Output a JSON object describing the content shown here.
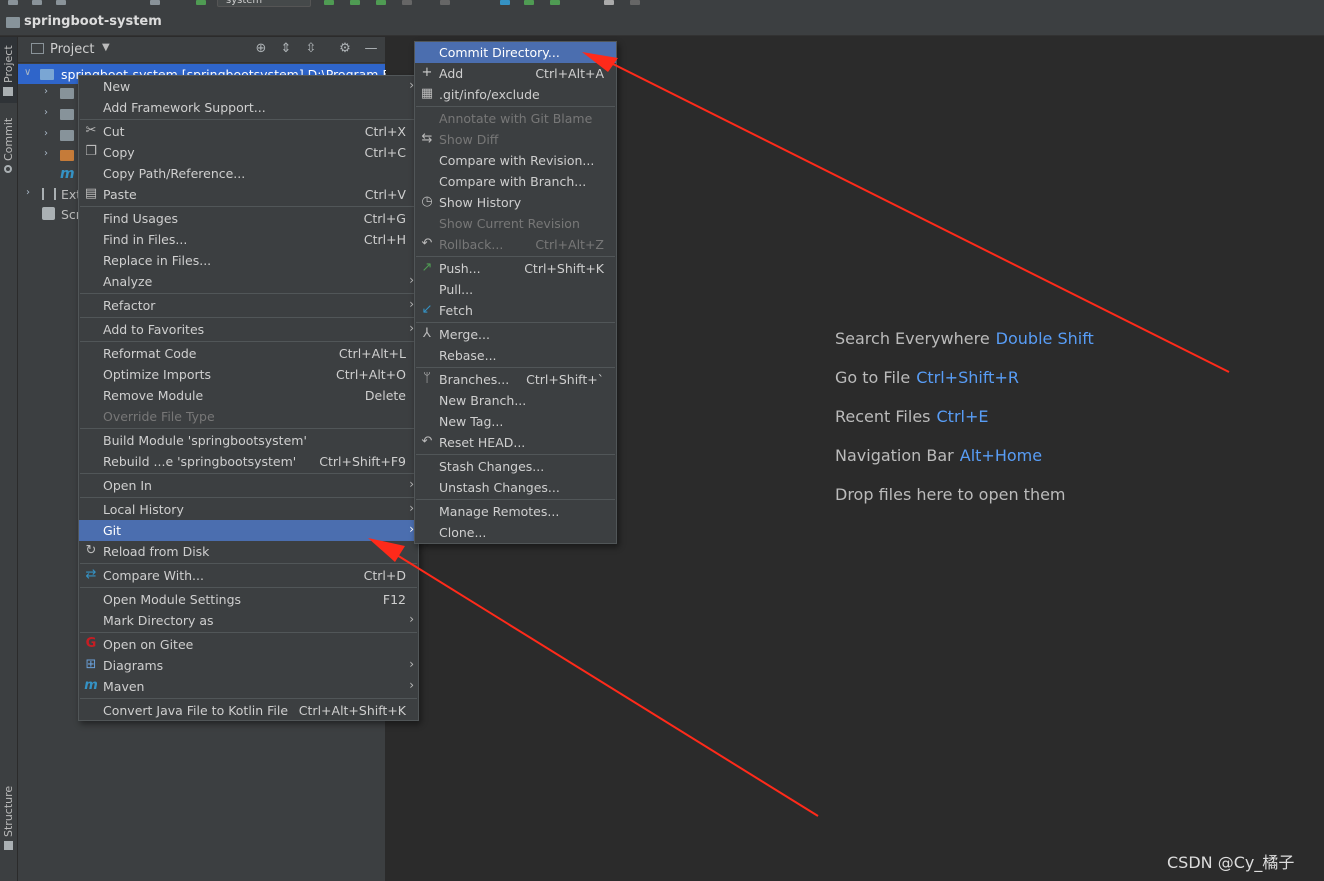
{
  "window": {
    "title": "springboot-system",
    "run_config": "system"
  },
  "left_strip": {
    "tabs": [
      "Project",
      "Commit",
      "Structure"
    ]
  },
  "project_panel": {
    "title": "Project",
    "tree": [
      {
        "text": "springboot-system [springbootsystem]  D:\\Program Fil",
        "selected": true
      },
      {
        "text": "",
        "folder": "gray"
      },
      {
        "text": "",
        "folder": "gray"
      },
      {
        "text": "",
        "folder": "gray"
      },
      {
        "text": "",
        "folder": "orange"
      },
      {
        "text": "",
        "icon": "maven-icon"
      },
      {
        "text": "Ext"
      },
      {
        "text": "Scr"
      }
    ]
  },
  "context_menu": {
    "items": [
      {
        "label": "New",
        "submenu": true
      },
      {
        "label": "Add Framework Support..."
      },
      {
        "sep": true
      },
      {
        "label": "Cut",
        "shortcut": "Ctrl+X",
        "icon": "scissors-icon"
      },
      {
        "label": "Copy",
        "shortcut": "Ctrl+C",
        "icon": "copy-icon"
      },
      {
        "label": "Copy Path/Reference..."
      },
      {
        "label": "Paste",
        "shortcut": "Ctrl+V",
        "icon": "paste-icon"
      },
      {
        "sep": true
      },
      {
        "label": "Find Usages",
        "shortcut": "Ctrl+G"
      },
      {
        "label": "Find in Files...",
        "shortcut": "Ctrl+H"
      },
      {
        "label": "Replace in Files..."
      },
      {
        "label": "Analyze",
        "submenu": true
      },
      {
        "sep": true
      },
      {
        "label": "Refactor",
        "submenu": true
      },
      {
        "sep": true
      },
      {
        "label": "Add to Favorites",
        "submenu": true
      },
      {
        "sep": true
      },
      {
        "label": "Reformat Code",
        "shortcut": "Ctrl+Alt+L"
      },
      {
        "label": "Optimize Imports",
        "shortcut": "Ctrl+Alt+O"
      },
      {
        "label": "Remove Module",
        "shortcut": "Delete"
      },
      {
        "label": "Override File Type",
        "disabled": true
      },
      {
        "sep": true
      },
      {
        "label": "Build Module 'springbootsystem'"
      },
      {
        "label": "Rebuild ...e 'springbootsystem'",
        "shortcut": "Ctrl+Shift+F9"
      },
      {
        "sep": true
      },
      {
        "label": "Open In",
        "submenu": true
      },
      {
        "sep": true
      },
      {
        "label": "Local History",
        "submenu": true
      },
      {
        "label": "Git",
        "submenu": true,
        "highlighted": true
      },
      {
        "label": "Reload from Disk",
        "icon": "reload-icon"
      },
      {
        "sep": true
      },
      {
        "label": "Compare With...",
        "shortcut": "Ctrl+D",
        "icon": "compare-icon"
      },
      {
        "sep": true
      },
      {
        "label": "Open Module Settings",
        "shortcut": "F12"
      },
      {
        "label": "Mark Directory as",
        "submenu": true
      },
      {
        "sep": true
      },
      {
        "label": "Open on Gitee",
        "icon": "gitee-icon"
      },
      {
        "label": "Diagrams",
        "submenu": true,
        "icon": "diagram-icon"
      },
      {
        "label": "Maven",
        "submenu": true,
        "icon": "maven-icon"
      },
      {
        "sep": true
      },
      {
        "label": "Convert Java File to Kotlin File",
        "shortcut": "Ctrl+Alt+Shift+K"
      }
    ]
  },
  "git_menu": {
    "items": [
      {
        "label": "Commit Directory...",
        "highlighted": true
      },
      {
        "label": "Add",
        "shortcut": "Ctrl+Alt+A",
        "icon": "plus-icon"
      },
      {
        "label": ".git/info/exclude",
        "icon": "git-file-icon"
      },
      {
        "sep": true
      },
      {
        "label": "Annotate with Git Blame",
        "disabled": true
      },
      {
        "label": "Show Diff",
        "disabled": true,
        "icon": "diff-icon"
      },
      {
        "label": "Compare with Revision..."
      },
      {
        "label": "Compare with Branch..."
      },
      {
        "label": "Show History",
        "icon": "clock-icon"
      },
      {
        "label": "Show Current Revision",
        "disabled": true
      },
      {
        "label": "Rollback...",
        "shortcut": "Ctrl+Alt+Z",
        "disabled": true,
        "icon": "rollback-icon"
      },
      {
        "sep": true
      },
      {
        "label": "Push...",
        "shortcut": "Ctrl+Shift+K",
        "icon": "push-icon"
      },
      {
        "label": "Pull..."
      },
      {
        "label": "Fetch",
        "icon": "fetch-icon"
      },
      {
        "sep": true
      },
      {
        "label": "Merge...",
        "icon": "merge-icon"
      },
      {
        "label": "Rebase..."
      },
      {
        "sep": true
      },
      {
        "label": "Branches...",
        "shortcut": "Ctrl+Shift+`",
        "icon": "branch-icon"
      },
      {
        "label": "New Branch..."
      },
      {
        "label": "New Tag..."
      },
      {
        "label": "Reset HEAD...",
        "icon": "reset-icon"
      },
      {
        "sep": true
      },
      {
        "label": "Stash Changes..."
      },
      {
        "label": "Unstash Changes..."
      },
      {
        "sep": true
      },
      {
        "label": "Manage Remotes..."
      },
      {
        "label": "Clone..."
      }
    ]
  },
  "editor_hints": [
    {
      "label": "Search Everywhere",
      "key": "Double Shift"
    },
    {
      "label": "Go to File",
      "key": "Ctrl+Shift+R"
    },
    {
      "label": "Recent Files",
      "key": "Ctrl+E"
    },
    {
      "label": "Navigation Bar",
      "key": "Alt+Home"
    },
    {
      "label": "Drop files here to open them",
      "key": ""
    }
  ],
  "watermark": "CSDN @Cy_橘子",
  "colors": {
    "background": "#2b2b2b",
    "panel": "#3c3f41",
    "menu_highlight": "#4b6eaf",
    "selection": "#2f65ca",
    "hint_key": "#589df6",
    "annotation_arrow": "#ff2a1a"
  }
}
